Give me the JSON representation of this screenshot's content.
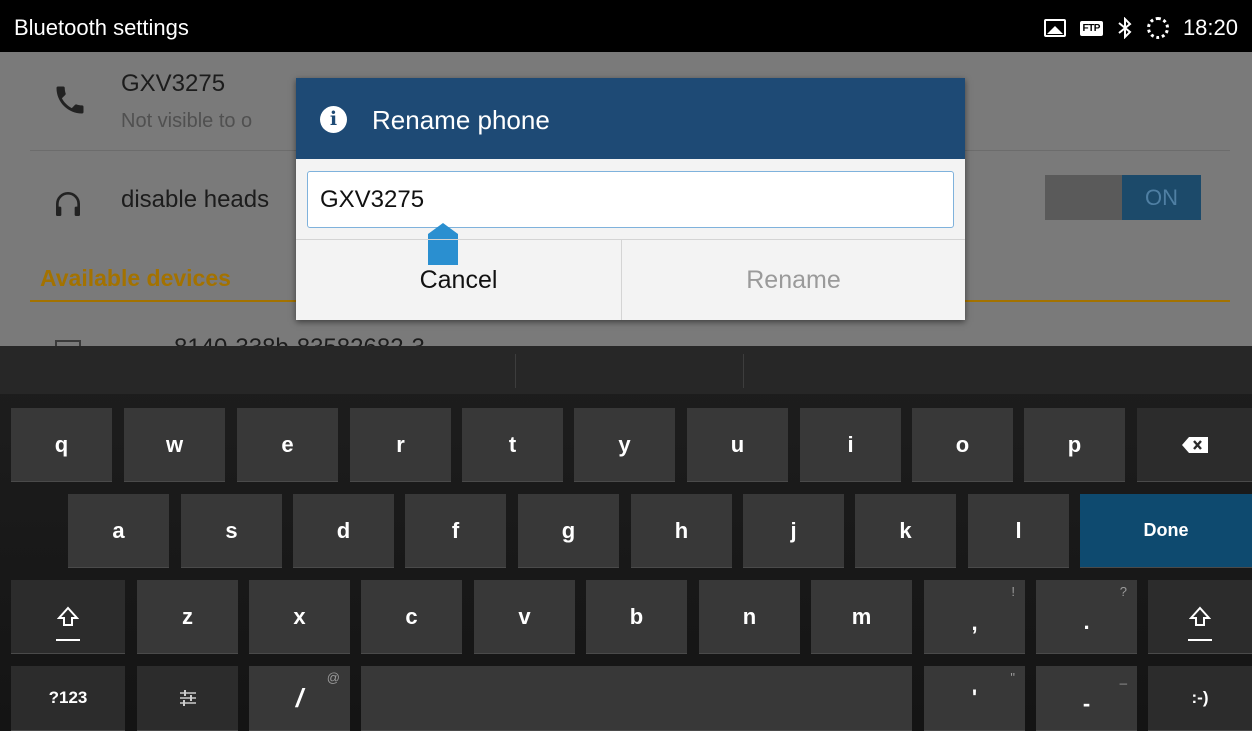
{
  "titlebar": {
    "title": "Bluetooth settings",
    "ftp_label": "FTP",
    "time": "18:20"
  },
  "settings": {
    "device_name": "GXV3275",
    "device_subtitle": "Not visible to o",
    "headset_label": "disable heads",
    "toggle_label": "ON",
    "section_label": "Available devices",
    "peek_text": "8140-338b-83582682-3"
  },
  "dialog": {
    "title": "Rename phone",
    "input_value": "GXV3275",
    "cancel_label": "Cancel",
    "rename_label": "Rename"
  },
  "keyboard": {
    "row1": [
      "q",
      "w",
      "e",
      "r",
      "t",
      "y",
      "u",
      "i",
      "o",
      "p"
    ],
    "row2": [
      "a",
      "s",
      "d",
      "f",
      "g",
      "h",
      "j",
      "k",
      "l"
    ],
    "done_label": "Done",
    "row3": [
      "z",
      "x",
      "c",
      "v",
      "b",
      "n",
      "m"
    ],
    "comma": ",",
    "comma_hint": "!",
    "period": ".",
    "period_hint": "?",
    "symbols_label": "?123",
    "slash": "/",
    "slash_hint": "@",
    "apostrophe": "'",
    "apostrophe_hint": "\"",
    "dash": "-",
    "dash_hint": "_",
    "smiley": ":-)"
  },
  "colors": {
    "dialog_header": "#1e4a75",
    "section_accent": "#a37200",
    "done_key": "#0e4a6f"
  }
}
